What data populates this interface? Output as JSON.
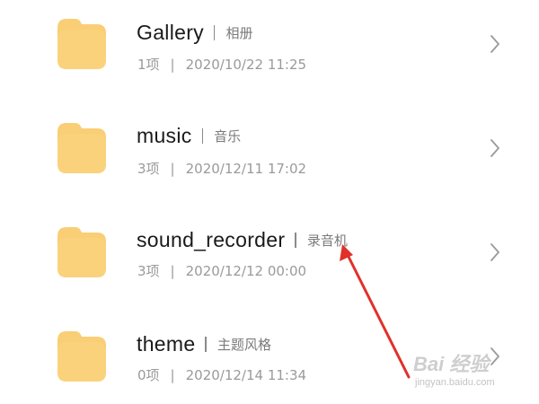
{
  "colors": {
    "folder_body": "#F9CE75",
    "folder_tab": "#FBD98A",
    "name_text": "#1A1A1A",
    "meta_text": "#9A9A9A",
    "annotation_arrow": "#E0312A"
  },
  "folders": [
    {
      "name": "Gallery",
      "alias": "相册",
      "count": "1项",
      "date": "2020/10/22 11:25",
      "icon": "folder-icon"
    },
    {
      "name": "music",
      "alias": "音乐",
      "count": "3项",
      "date": "2020/12/11 17:02",
      "icon": "folder-icon"
    },
    {
      "name": "sound_recorder",
      "alias": "录音机",
      "count": "3项",
      "date": "2020/12/12 00:00",
      "icon": "folder-icon"
    },
    {
      "name": "theme",
      "alias": "主题风格",
      "count": "0项",
      "date": "2020/12/14 11:34",
      "icon": "folder-icon"
    }
  ],
  "watermark": {
    "brand": "Bai 经验",
    "url": "jingyan.baidu.com"
  }
}
